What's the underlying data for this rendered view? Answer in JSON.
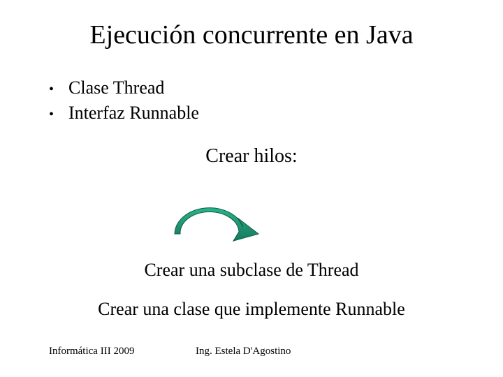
{
  "title": "Ejecución concurrente en Java",
  "bullets": {
    "items": [
      "Clase Thread",
      "Interfaz Runnable"
    ]
  },
  "subhead": "Crear hilos:",
  "body": {
    "line1": "Crear una subclase de Thread",
    "line2": "Crear una clase que implemente Runnable"
  },
  "footer": {
    "left": "Informática III 2009",
    "center": "Ing. Estela D'Agostino"
  },
  "colors": {
    "arrow": "#1f9e7a"
  }
}
